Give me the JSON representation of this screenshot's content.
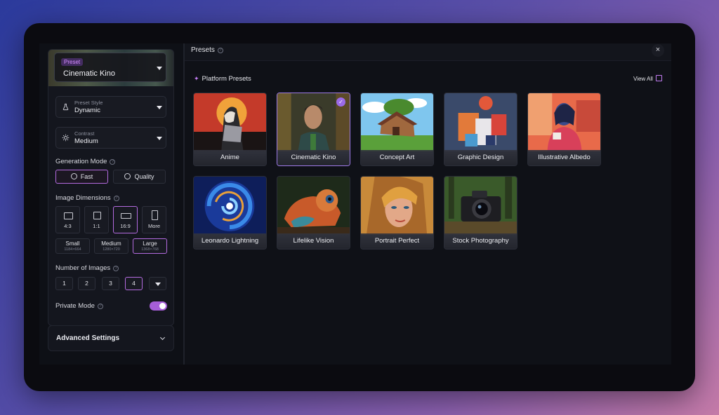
{
  "sidebar": {
    "preset": {
      "tag": "Preset",
      "value": "Cinematic Kino"
    },
    "preset_style": {
      "label": "Preset Style",
      "value": "Dynamic"
    },
    "contrast": {
      "label": "Contrast",
      "value": "Medium"
    },
    "generation_mode": {
      "title": "Generation Mode",
      "options": [
        "Fast",
        "Quality"
      ],
      "selected": "Fast"
    },
    "image_dimensions": {
      "title": "Image Dimensions",
      "ratios": [
        "4:3",
        "1:1",
        "16:9",
        "More"
      ],
      "selected_ratio": "16:9",
      "sizes": [
        {
          "name": "Small",
          "dims": "1184×664"
        },
        {
          "name": "Medium",
          "dims": "1280×720"
        },
        {
          "name": "Large",
          "dims": "1368×768"
        }
      ],
      "selected_size": "Large"
    },
    "number_of_images": {
      "title": "Number of Images",
      "options": [
        "1",
        "2",
        "3",
        "4"
      ],
      "selected": "4"
    },
    "private_mode": {
      "title": "Private Mode",
      "enabled": true
    },
    "advanced_settings": "Advanced Settings"
  },
  "main": {
    "title": "Presets",
    "section_title": "Platform Presets",
    "view_all": "View All",
    "presets": [
      {
        "name": "Anime",
        "selected": false
      },
      {
        "name": "Cinematic Kino",
        "selected": true
      },
      {
        "name": "Concept Art",
        "selected": false
      },
      {
        "name": "Graphic Design",
        "selected": false
      },
      {
        "name": "Illustrative Albedo",
        "selected": false
      },
      {
        "name": "Leonardo Lightning",
        "selected": false
      },
      {
        "name": "Lifelike Vision",
        "selected": false
      },
      {
        "name": "Portrait Perfect",
        "selected": false
      },
      {
        "name": "Stock Photography",
        "selected": false
      }
    ]
  },
  "colors": {
    "accent": "#b46be0",
    "toggle_on": "#a65ed8",
    "background": "#0f1117"
  }
}
